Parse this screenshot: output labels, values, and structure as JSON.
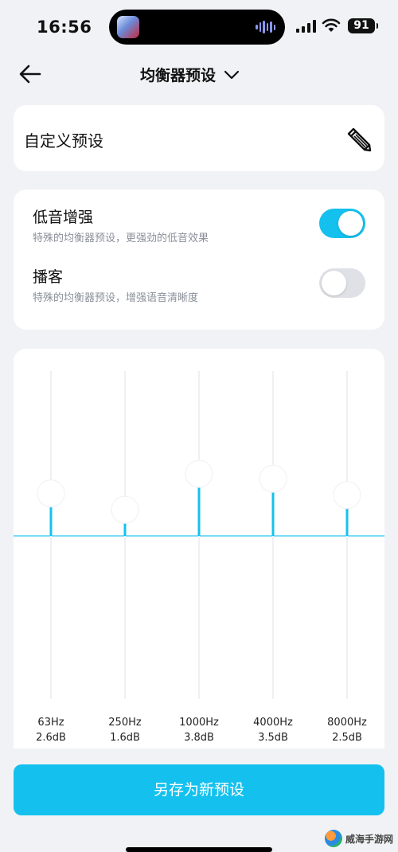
{
  "status_bar": {
    "time": "16:56",
    "battery": "91"
  },
  "nav": {
    "title": "均衡器预设"
  },
  "preset": {
    "name": "自定义预设"
  },
  "toggles": [
    {
      "title": "低音增强",
      "desc": "特殊的均衡器预设，更强劲的低音效果",
      "on": true
    },
    {
      "title": "播客",
      "desc": "特殊的均衡器预设，增强语音清晰度",
      "on": false
    }
  ],
  "equalizer": {
    "bands": [
      {
        "freq": "63Hz",
        "gain": "2.6dB",
        "value": 2.6
      },
      {
        "freq": "250Hz",
        "gain": "1.6dB",
        "value": 1.6
      },
      {
        "freq": "1000Hz",
        "gain": "3.8dB",
        "value": 3.8
      },
      {
        "freq": "4000Hz",
        "gain": "3.5dB",
        "value": 3.5
      },
      {
        "freq": "8000Hz",
        "gain": "2.5dB",
        "value": 2.5
      }
    ]
  },
  "save_button": {
    "label": "另存为新预设"
  },
  "watermark": {
    "text": "威海手游网"
  },
  "colors": {
    "accent": "#14c1ee",
    "track": "#eef0f3",
    "background": "#f1f2f5"
  }
}
